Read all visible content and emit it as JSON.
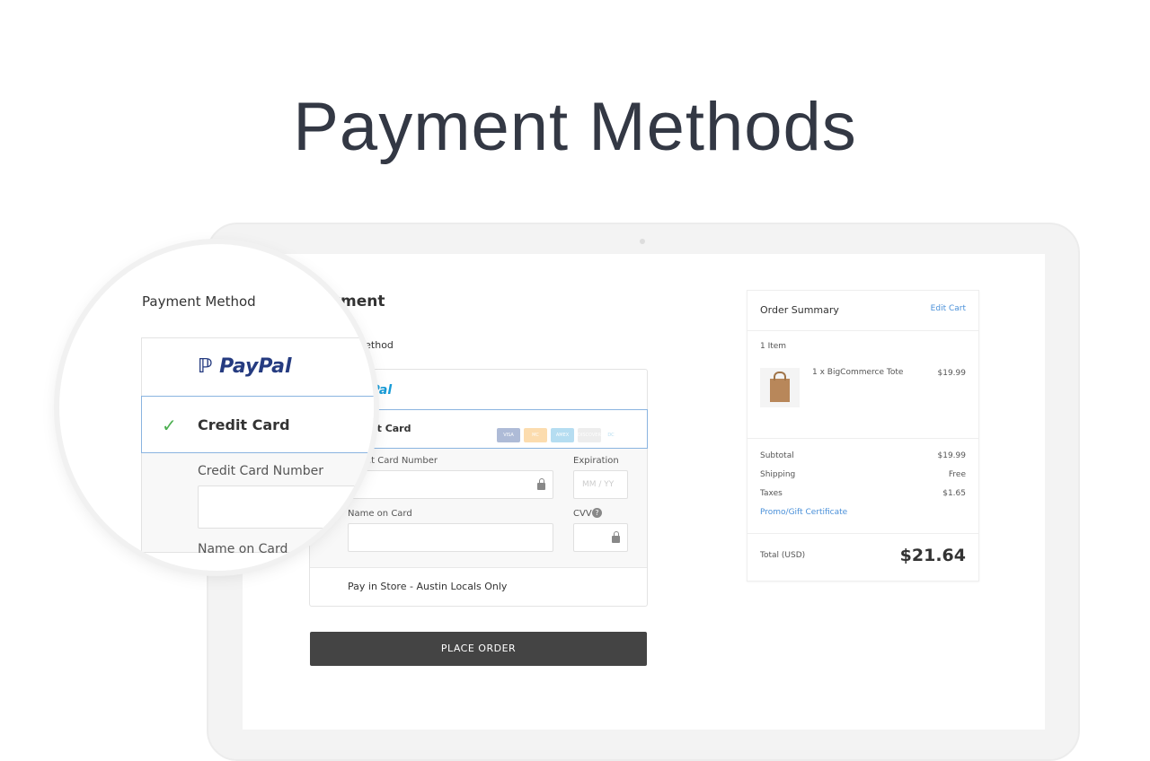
{
  "page_title": "Payment Methods",
  "checkout": {
    "heading": "Payment",
    "method_label": "Payment Method",
    "paypal": "PayPal",
    "credit_card": "Credit Card",
    "card_brands": [
      "VISA",
      "MC",
      "AMEX",
      "DISCOVER",
      "DC"
    ],
    "card_number_label": "Credit Card Number",
    "expiration_label": "Expiration",
    "expiration_placeholder": "MM / YY",
    "name_label": "Name on Card",
    "cvv_label": "CVV",
    "pay_in_store": "Pay in Store - Austin Locals Only",
    "place_order": "PLACE ORDER"
  },
  "summary": {
    "title": "Order Summary",
    "edit_cart": "Edit Cart",
    "item_count": "1 Item",
    "item_name": "1 x BigCommerce Tote",
    "item_price": "$19.99",
    "subtotal_label": "Subtotal",
    "subtotal": "$19.99",
    "shipping_label": "Shipping",
    "shipping": "Free",
    "taxes_label": "Taxes",
    "taxes": "$1.65",
    "promo": "Promo/Gift Certificate",
    "total_label": "Total (USD)",
    "total": "$21.64"
  },
  "colors": {
    "accent": "#4a90d9",
    "paypal_dark": "#253b80",
    "paypal_light": "#179bd7",
    "check": "#4caf50"
  }
}
